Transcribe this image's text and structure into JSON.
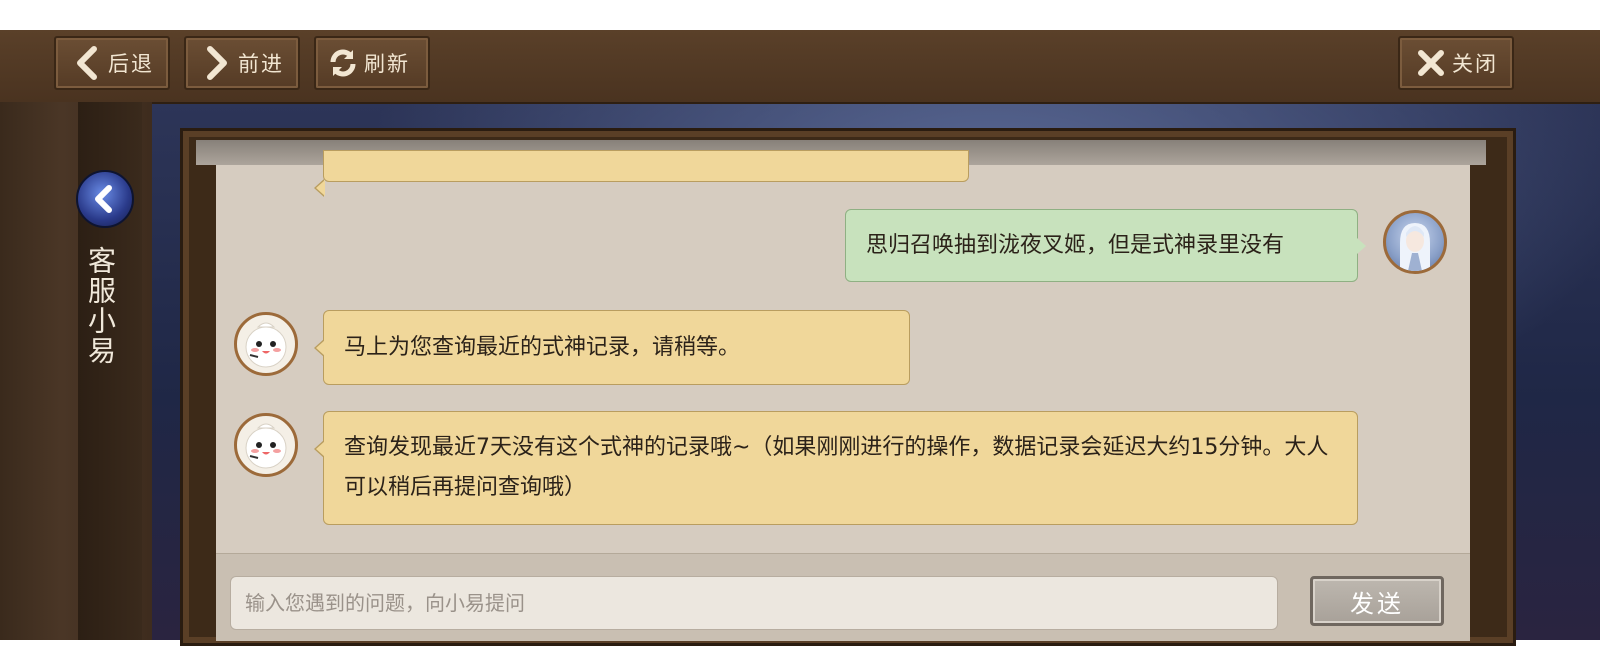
{
  "toolbar": {
    "back_label": "后退",
    "forward_label": "前进",
    "refresh_label": "刷新",
    "close_label": "关闭"
  },
  "sidebar": {
    "title": "客服小易"
  },
  "chat": {
    "messages": [
      {
        "sender": "user",
        "text": "思归召唤抽到泷夜叉姬，但是式神录里没有"
      },
      {
        "sender": "bot",
        "text": "马上为您查询最近的式神记录，请稍等。"
      },
      {
        "sender": "bot",
        "text": "查询发现最近7天没有这个式神的记录哦~（如果刚刚进行的操作，数据记录会延迟大约15分钟。大人可以稍后再提问查询哦）"
      }
    ]
  },
  "composer": {
    "placeholder": "输入您遇到的问题，向小易提问",
    "send_label": "发送"
  },
  "icons": {
    "back": "chevron-left-icon",
    "forward": "chevron-right-icon",
    "refresh": "refresh-icon",
    "close": "close-icon",
    "side_back": "back-arrow-icon"
  }
}
